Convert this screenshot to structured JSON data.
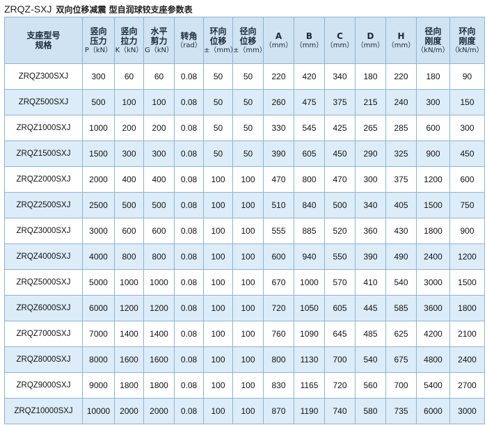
{
  "title": {
    "model": "ZRQZ-SXJ",
    "description": "双向位移减震 型自润球铰支座参数表"
  },
  "headers": [
    {
      "line1": "支座型号",
      "line2": "规格",
      "unit": ""
    },
    {
      "line1": "竖向",
      "line2": "压力",
      "unit": "P（kN）"
    },
    {
      "line1": "竖向",
      "line2": "拉力",
      "unit": "K（kN）"
    },
    {
      "line1": "水平",
      "line2": "剪力",
      "unit": "G（kN）"
    },
    {
      "line1": "转角",
      "line2": "",
      "unit": "（rad）"
    },
    {
      "line1": "环向",
      "line2": "位移",
      "unit": "±（mm）"
    },
    {
      "line1": "径向",
      "line2": "位移",
      "unit": "±（mm）"
    },
    {
      "line1": "A",
      "line2": "",
      "unit": "（mm）"
    },
    {
      "line1": "B",
      "line2": "",
      "unit": "（mm）"
    },
    {
      "line1": "C",
      "line2": "",
      "unit": "（mm）"
    },
    {
      "line1": "D",
      "line2": "",
      "unit": "（mm）"
    },
    {
      "line1": "H",
      "line2": "",
      "unit": "（mm）"
    },
    {
      "line1": "径向",
      "line2": "刚度",
      "unit": "（kN/m）"
    },
    {
      "line1": "环向",
      "line2": "刚度",
      "unit": "（kN/m）"
    }
  ],
  "rows": [
    [
      "ZRQZ300SXJ",
      "300",
      "60",
      "60",
      "0.08",
      "50",
      "50",
      "220",
      "420",
      "340",
      "180",
      "220",
      "180",
      "90"
    ],
    [
      "ZRQZ500SXJ",
      "500",
      "100",
      "100",
      "0.08",
      "50",
      "50",
      "260",
      "475",
      "375",
      "215",
      "240",
      "300",
      "150"
    ],
    [
      "ZRQZ1000SXJ",
      "1000",
      "200",
      "200",
      "0.08",
      "50",
      "50",
      "330",
      "545",
      "425",
      "265",
      "285",
      "600",
      "300"
    ],
    [
      "ZRQZ1500SXJ",
      "1500",
      "300",
      "300",
      "0.08",
      "50",
      "50",
      "390",
      "605",
      "450",
      "290",
      "325",
      "900",
      "450"
    ],
    [
      "ZRQZ2000SXJ",
      "2000",
      "400",
      "400",
      "0.08",
      "100",
      "100",
      "470",
      "800",
      "470",
      "300",
      "375",
      "1200",
      "600"
    ],
    [
      "ZRQZ2500SXJ",
      "2500",
      "500",
      "500",
      "0.08",
      "100",
      "100",
      "510",
      "840",
      "500",
      "340",
      "405",
      "1500",
      "750"
    ],
    [
      "ZRQZ3000SXJ",
      "3000",
      "600",
      "600",
      "0.08",
      "100",
      "100",
      "555",
      "885",
      "520",
      "360",
      "430",
      "1800",
      "900"
    ],
    [
      "ZRQZ4000SXJ",
      "4000",
      "800",
      "800",
      "0.08",
      "100",
      "100",
      "600",
      "940",
      "550",
      "390",
      "490",
      "2400",
      "1200"
    ],
    [
      "ZRQZ5000SXJ",
      "5000",
      "1000",
      "1000",
      "0.08",
      "100",
      "100",
      "670",
      "1000",
      "570",
      "410",
      "540",
      "3000",
      "1500"
    ],
    [
      "ZRQZ6000SXJ",
      "6000",
      "1200",
      "1200",
      "0.08",
      "100",
      "100",
      "720",
      "1050",
      "605",
      "445",
      "585",
      "3600",
      "1800"
    ],
    [
      "ZRQZ7000SXJ",
      "7000",
      "1400",
      "1400",
      "0.08",
      "100",
      "100",
      "760",
      "1090",
      "645",
      "485",
      "625",
      "4200",
      "2100"
    ],
    [
      "ZRQZ8000SXJ",
      "8000",
      "1600",
      "1600",
      "0.08",
      "100",
      "100",
      "800",
      "1130",
      "700",
      "540",
      "675",
      "4800",
      "2400"
    ],
    [
      "ZRQZ9000SXJ",
      "9000",
      "1800",
      "1800",
      "0.08",
      "100",
      "100",
      "830",
      "1165",
      "720",
      "560",
      "700",
      "5400",
      "2700"
    ],
    [
      "ZRQZ10000SXJ",
      "10000",
      "2000",
      "2000",
      "0.08",
      "100",
      "100",
      "870",
      "1190",
      "740",
      "580",
      "735",
      "6000",
      "3000"
    ]
  ]
}
